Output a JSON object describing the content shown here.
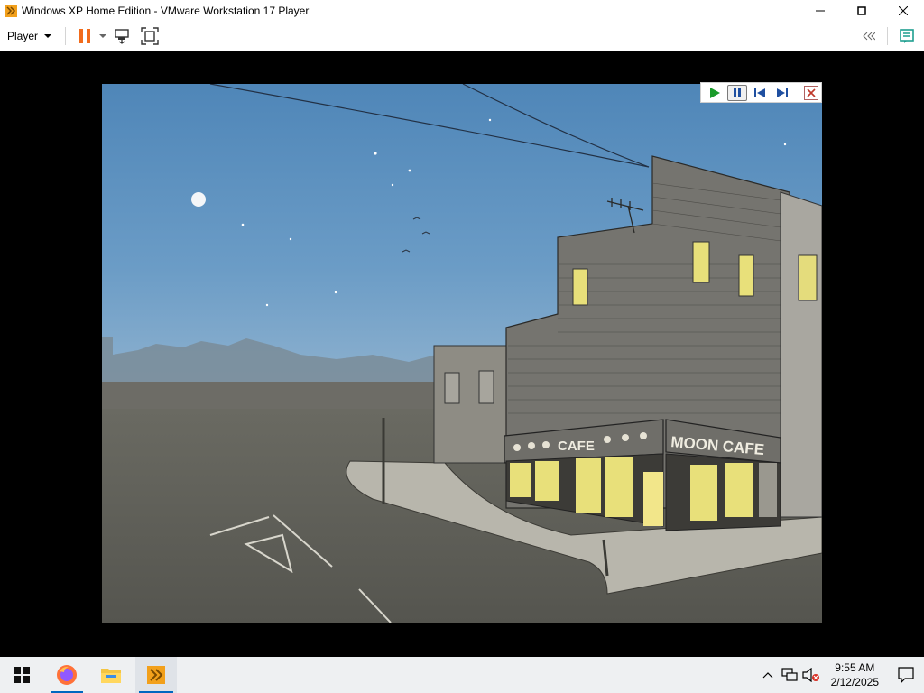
{
  "window": {
    "title": "Windows XP Home Edition - VMware Workstation 17 Player",
    "minimize_icon": "minimize-icon",
    "maximize_icon": "restore-icon",
    "close_icon": "close-icon"
  },
  "toolbar": {
    "player_menu_label": "Player",
    "icons": [
      "pause-icon",
      "send-ctrl-alt-del-icon",
      "fullscreen-icon",
      "collapse-icon",
      "notes-icon"
    ]
  },
  "guest_screen": {
    "scene": "night street illustration",
    "sign_left": "CAFE",
    "sign_right": "MOON CAFE",
    "media_controls": [
      "play-icon",
      "pause-icon",
      "previous-icon",
      "next-icon",
      "close-icon"
    ]
  },
  "taskbar": {
    "apps": [
      "windows-start-icon",
      "firefox-icon",
      "file-explorer-icon",
      "vmware-icon"
    ],
    "clock_time": "9:55 AM",
    "clock_date": "2/12/2025"
  },
  "colors": {
    "accent": "#0067c0",
    "vmware_orange": "#f29111",
    "sky": "#5b8fbf",
    "window_lit": "#e8e07a"
  }
}
